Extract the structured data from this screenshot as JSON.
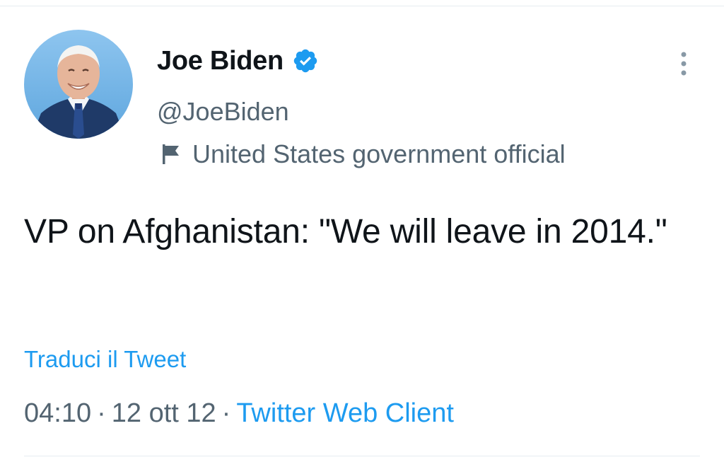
{
  "author": {
    "display_name": "Joe Biden",
    "handle": "@JoeBiden",
    "verified": true,
    "label": "United States government official"
  },
  "tweet": {
    "text": "VP on Afghanistan: \"We will leave in 2014.\"",
    "translate_label": "Traduci il Tweet",
    "time": "04:10",
    "date": "12 ott 12",
    "separator": "·",
    "source": "Twitter Web Client"
  },
  "icons": {
    "verified": "verified-badge-icon",
    "label": "flag-icon",
    "more": "more-vertical-icon"
  },
  "colors": {
    "link": "#1d9bf0",
    "secondary_text": "#536471",
    "primary_text": "#0f1419",
    "verified": "#1d9bf0"
  }
}
